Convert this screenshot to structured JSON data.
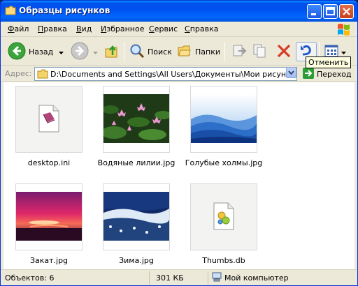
{
  "window": {
    "title": "Образцы рисунков"
  },
  "menu": {
    "items": [
      {
        "first": "Ф",
        "rest": "айл"
      },
      {
        "first": "П",
        "rest": "равка"
      },
      {
        "first": "В",
        "rest": "ид"
      },
      {
        "first": "И",
        "rest": "збранное"
      },
      {
        "first": "С",
        "rest": "ервис"
      },
      {
        "first": "С",
        "rest": "правка"
      }
    ]
  },
  "toolbar": {
    "back_label": "Назад",
    "search_label": "Поиск",
    "folders_label": "Папки"
  },
  "tooltip": {
    "text": "Отменить"
  },
  "address": {
    "label": "Адрес:",
    "path": "D:\\Documents and Settings\\All Users\\Документы\\Мои рисунки\\Образцы рисунков",
    "go_label": "Переход"
  },
  "files": [
    {
      "name": "desktop.ini",
      "type": "ini-file-icon"
    },
    {
      "name": "Водяные лилии.jpg",
      "type": "image"
    },
    {
      "name": "Голубые холмы.jpg",
      "type": "image"
    },
    {
      "name": "Закат.jpg",
      "type": "image"
    },
    {
      "name": "Зима.jpg",
      "type": "image"
    },
    {
      "name": "Thumbs.db",
      "type": "db-file-icon"
    }
  ],
  "status": {
    "objects": "Объектов: 6",
    "size": "301 КБ",
    "location": "Мой компьютер"
  },
  "colors": {
    "titlebar": "#0054e3",
    "window_bg": "#ece9d8",
    "go_arrow": "#2a9d35",
    "close_red": "#d83b26"
  }
}
